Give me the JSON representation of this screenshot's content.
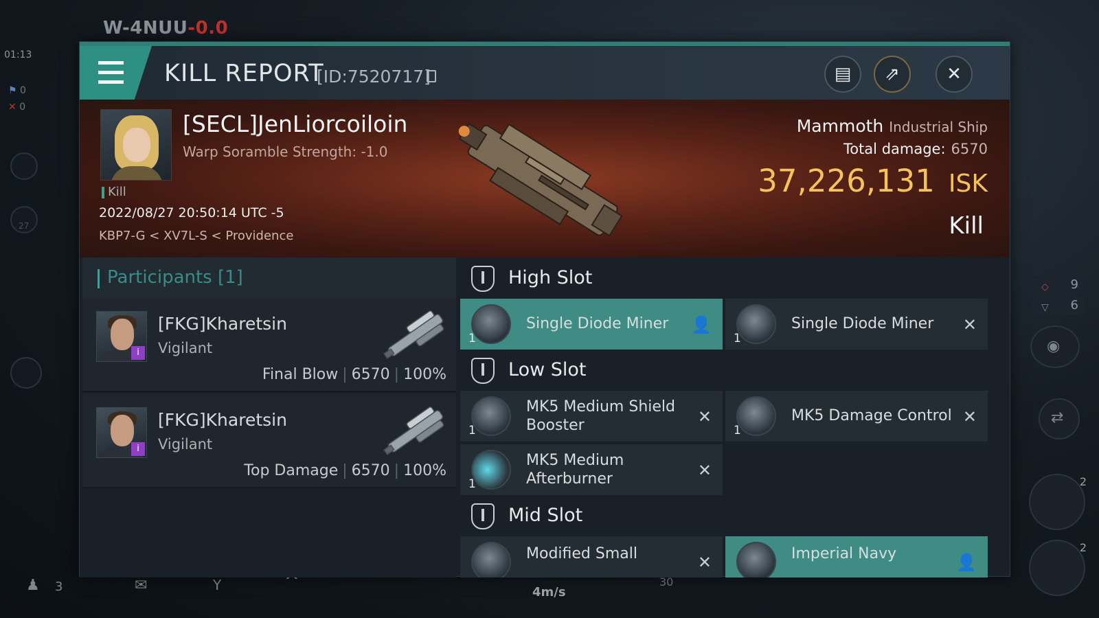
{
  "hud": {
    "system": "W-4NUU",
    "security": "-0.0",
    "clock": "01:13",
    "counter_blue": "0",
    "counter_red": "0",
    "stat_one": "9",
    "stat_two": "6",
    "speed": "4m/s",
    "bottom_count": "3",
    "bottom_num": "30",
    "drone_count_a": "2",
    "drone_count_b": "2",
    "dock_icon": "27"
  },
  "header": {
    "title": "KILL REPORT",
    "id": "[ID:7520717]",
    "buttons": [
      "clipboard-icon",
      "share-icon",
      "close-icon"
    ]
  },
  "victim": {
    "name": "[SECL]JenLiorcoiloin",
    "warp_scramble": "Warp Soramble Strength: -1.0",
    "tag": "Kill",
    "datetime": "2022/08/27 20:50:14 UTC -5",
    "location": "KBP7-G < XV7L-S < Providence",
    "ship": "Mammoth",
    "ship_class": "Industrial Ship",
    "total_damage_label": "Total damage:",
    "total_damage": "6570",
    "isk_value": "37,226,131",
    "isk_unit": "ISK",
    "result": "Kill"
  },
  "participants": {
    "title": "Participants [1]",
    "rows": [
      {
        "name": "[FKG]Kharetsin",
        "ship": "Vigilant",
        "role": "Final Blow",
        "damage": "6570",
        "percent": "100%"
      },
      {
        "name": "[FKG]Kharetsin",
        "ship": "Vigilant",
        "role": "Top Damage",
        "damage": "6570",
        "percent": "100%"
      }
    ]
  },
  "fitting": {
    "high_slot": "High Slot",
    "low_slot": "Low Slot",
    "mid_slot": "Mid Slot",
    "high": [
      {
        "name": "Single Diode Miner",
        "qty": "1",
        "status": "dropped"
      },
      {
        "name": "Single Diode Miner",
        "qty": "1",
        "status": "destroyed"
      }
    ],
    "low": [
      {
        "name": "MK5 Medium Shield Booster",
        "qty": "1",
        "status": "destroyed"
      },
      {
        "name": "MK5 Damage Control",
        "qty": "1",
        "status": "destroyed"
      },
      {
        "name": "MK5 Medium Afterburner",
        "qty": "1",
        "status": "destroyed"
      }
    ],
    "mid": [
      {
        "name": "Modified Small",
        "qty": "",
        "status": "destroyed"
      },
      {
        "name": "Imperial Navy",
        "qty": "",
        "status": "dropped"
      }
    ]
  }
}
